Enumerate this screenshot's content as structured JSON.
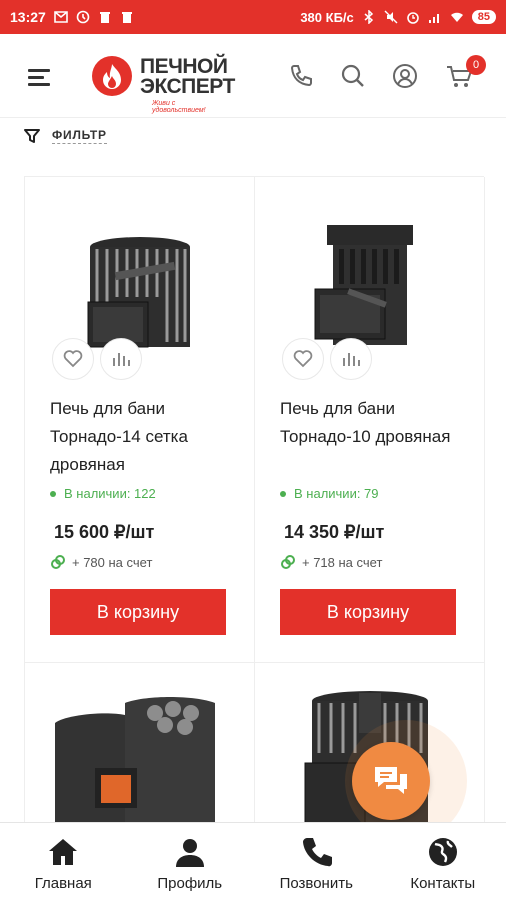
{
  "status_bar": {
    "time": "13:27",
    "speed": "380 КБ/с",
    "battery": "85"
  },
  "header": {
    "logo_line1": "ПЕЧНОЙ",
    "logo_line2": "ЭКСПЕРТ",
    "logo_slogan": "Живи с удовольствием!",
    "cart_count": "0",
    "icons": [
      "menu-icon",
      "phone-icon",
      "search-icon",
      "user-icon",
      "cart-icon"
    ]
  },
  "filter": {
    "label": "ФИЛЬТР"
  },
  "products": [
    {
      "title": "Печь для бани Торнадо-14 сетка дровяная",
      "stock": "В наличии: 122",
      "price": "15 600 ₽/шт",
      "bonus": "+ 780 на счет",
      "button": "В корзину"
    },
    {
      "title": "Печь для бани Торнадо-10 дровяная",
      "stock": "В наличии: 79",
      "price": "14 350 ₽/шт",
      "bonus": "+ 718 на счет",
      "button": "В корзину"
    }
  ],
  "bottom_nav": [
    {
      "label": "Главная",
      "icon": "home-icon"
    },
    {
      "label": "Профиль",
      "icon": "profile-icon"
    },
    {
      "label": "Позвонить",
      "icon": "phone-icon"
    },
    {
      "label": "Контакты",
      "icon": "globe-icon"
    }
  ],
  "colors": {
    "brand": "#e3312a",
    "stock": "#4caf50",
    "chat": "#f08a42"
  }
}
